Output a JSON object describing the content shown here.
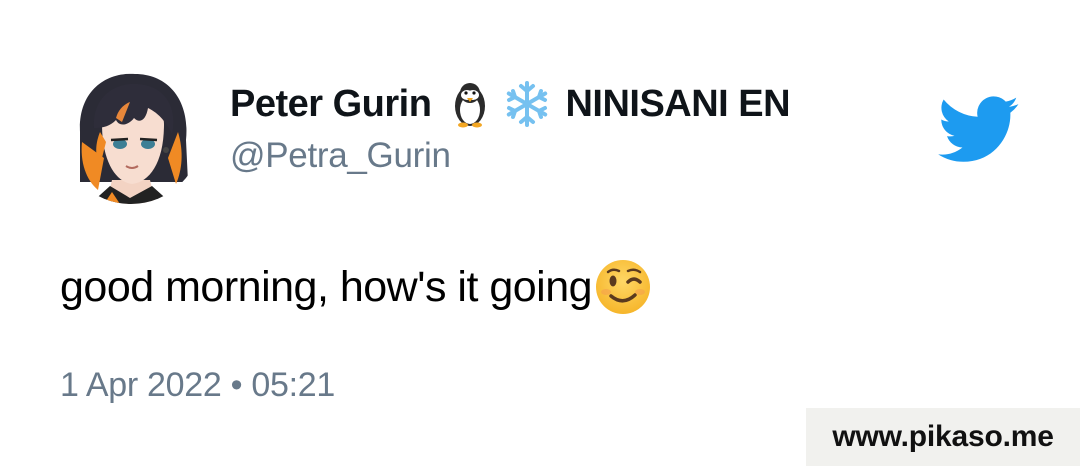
{
  "tweet": {
    "author": {
      "display_name": "Peter Gurin",
      "display_name_suffix": "NINISANI EN",
      "name_icons": [
        "penguin-icon",
        "snowflake-icon"
      ],
      "handle": "@Petra_Gurin",
      "avatar": "anime-avatar"
    },
    "text": "good morning, how's it going",
    "text_emoji": "wink-icon",
    "timestamp": "1 Apr 2022 • 05:21",
    "brand_icon": "twitter-bird-icon"
  },
  "watermark": {
    "text": "www.pikaso.me"
  },
  "colors": {
    "text_primary": "#0f1419",
    "text_secondary": "#68798a",
    "brand_blue": "#1d9bf0",
    "watermark_bg": "#f1f1ee"
  }
}
